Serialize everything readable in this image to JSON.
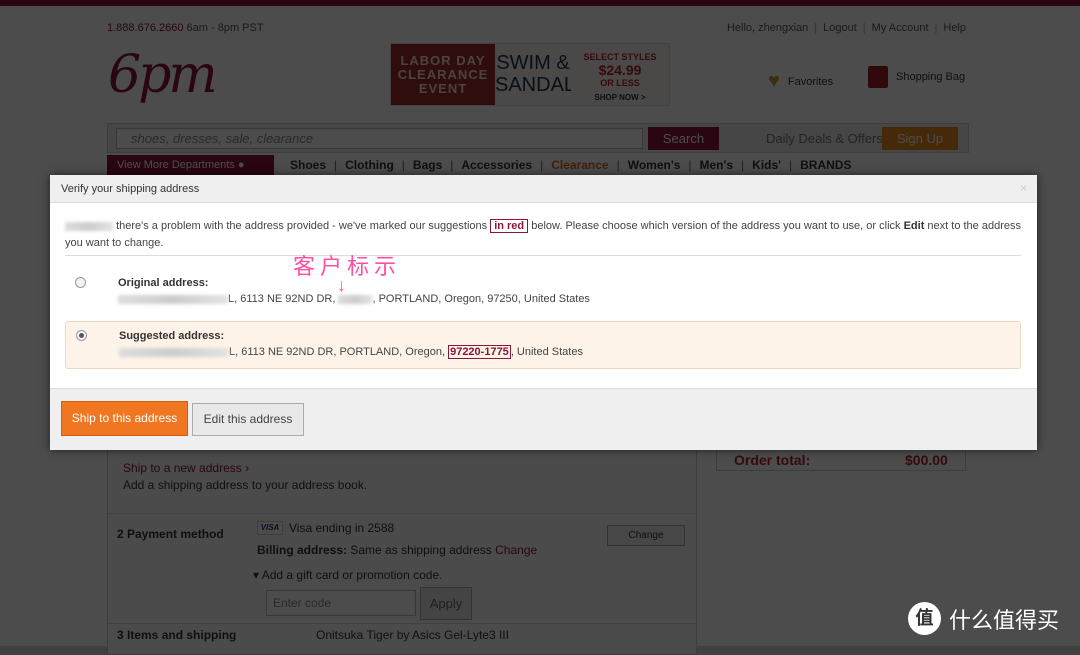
{
  "header": {
    "phone": "1.888.676.2660",
    "hours": "6am - 8pm PST",
    "greeting": "Hello, zhengxian",
    "logout": "Logout",
    "account": "My Account",
    "help": "Help",
    "logo": "6pm",
    "favorites": "Favorites",
    "bag": "Shopping Bag"
  },
  "banner": {
    "l1": "LABOR DAY",
    "l2": "CLEARANCE",
    "l3": "EVENT",
    "m1": "SWIM &",
    "m2": "SANDALS",
    "r1": "SELECT STYLES",
    "r2": "$24.99",
    "r3": "OR LESS",
    "r4": "SHOP NOW >"
  },
  "search": {
    "placeholder": "shoes, dresses, sale, clearance",
    "button": "Search",
    "deals": "Daily Deals & Offers",
    "signup": "Sign Up"
  },
  "nav": {
    "departments": "View More Departments",
    "items": [
      "Shoes",
      "Clothing",
      "Bags",
      "Accessories",
      "Clearance",
      "Women's",
      "Men's",
      "Kids'",
      "BRANDS"
    ]
  },
  "checkout": {
    "ship_new": "Ship to a new address ›",
    "add_ship": "Add a shipping address to your address book.",
    "payment_label": "2  Payment method",
    "visa_icon": "VISA",
    "visa": "Visa ending in 2588",
    "billing_label": "Billing address:",
    "billing_value": "Same as shipping address",
    "billing_change": "Change",
    "change": "Change",
    "gift": "▾  Add a gift card or promotion code.",
    "code_placeholder": "Enter code",
    "apply": "Apply",
    "items_label": "3  Items and shipping",
    "item_name": "Onitsuka Tiger by Asics Gel-Lyte3 III",
    "order_total": "Order total:",
    "order_total_value": "$00.00"
  },
  "modal": {
    "title": "Verify your shipping address",
    "close": "×",
    "msg_a": "there's a problem with the address provided - we've marked our suggestions",
    "in_red": "in red",
    "msg_b": "below. Please choose which version of the address you want to use, or click",
    "edit_word": "Edit",
    "msg_c": "next to the address you want to change.",
    "annotation": "客户标示",
    "original_title": "Original address:",
    "original_a": "L, 6113 NE 92ND DR,",
    "original_b": ", PORTLAND, Oregon, 97250, United States",
    "suggested_title": "Suggested address:",
    "suggested_a": "L, 6113 NE 92ND DR, PORTLAND, Oregon,",
    "suggested_zip": "97220-1775",
    "suggested_b": ", United States",
    "ship_button": "Ship to this address",
    "edit_button": "Edit this address",
    "selected": "suggested"
  },
  "watermark": {
    "icon": "值",
    "text": "什么值得买"
  },
  "colors": {
    "brand": "#8a1538",
    "accent": "#f07622"
  }
}
